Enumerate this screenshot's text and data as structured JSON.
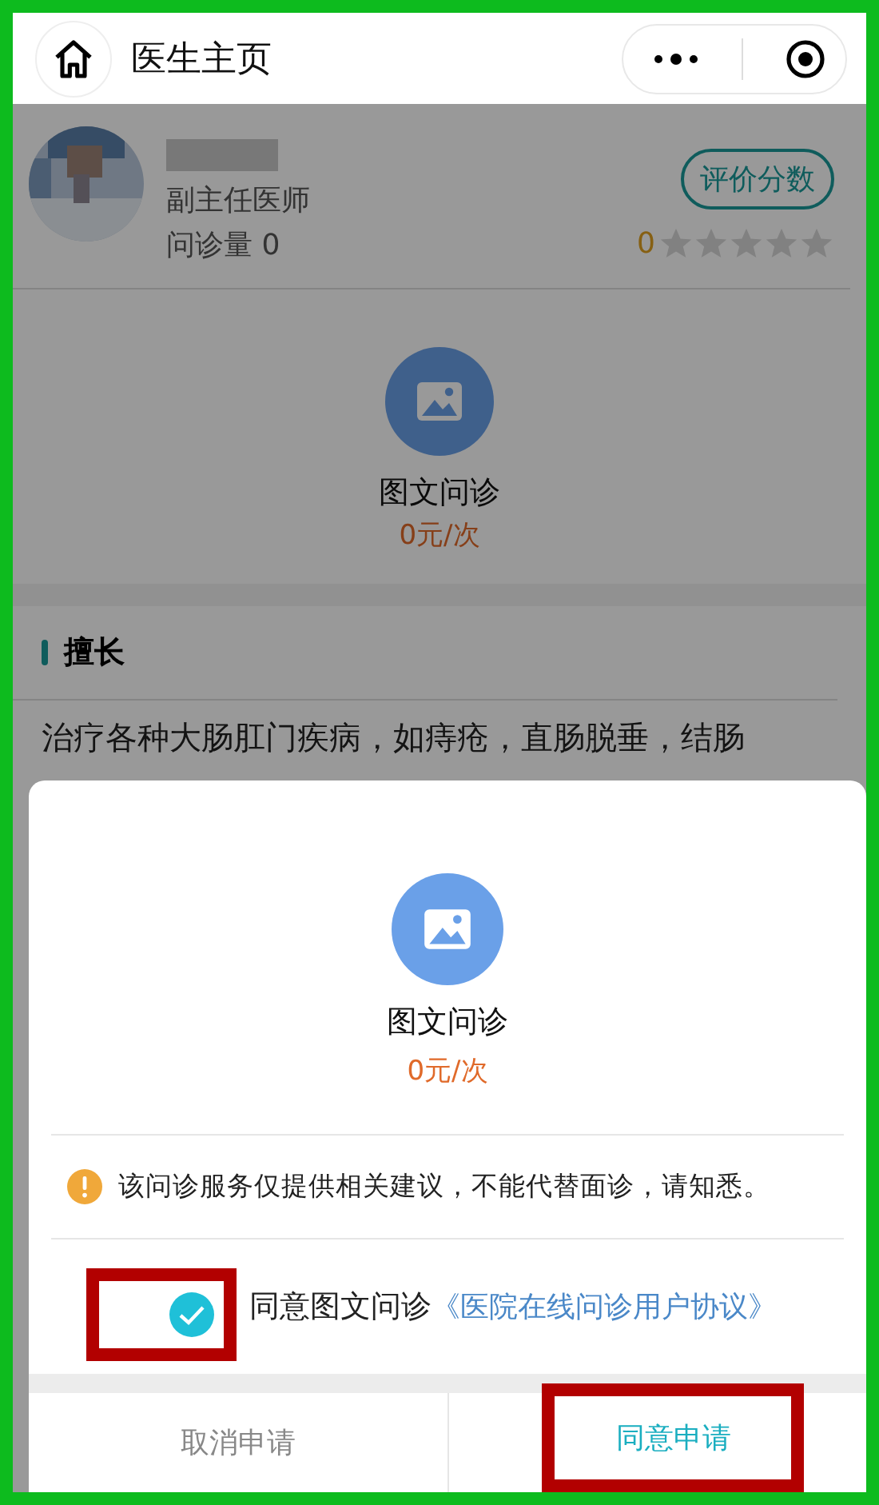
{
  "nav": {
    "title": "医生主页"
  },
  "doctor": {
    "title": "副主任医师",
    "consult_count": "问诊量 0",
    "rating_button": "评价分数",
    "score": "0",
    "stars": 0
  },
  "service": {
    "name": "图文问诊",
    "price": "0元/次"
  },
  "specialty": {
    "heading": "擅长",
    "text": "治疗各种大肠肛门疾病，如痔疮，直肠脱垂，结肠"
  },
  "sheet": {
    "service": {
      "name": "图文问诊",
      "price": "0元/次"
    },
    "notice": "该问诊服务仅提供相关建议，不能代替面诊，请知悉。",
    "agree": {
      "checked": true,
      "label": "同意图文问诊",
      "link": "《医院在线问诊用户协议》"
    },
    "buttons": [
      {
        "label": "取消申请",
        "kind": "cancel"
      },
      {
        "label": "同意申请",
        "kind": "confirm"
      }
    ]
  }
}
